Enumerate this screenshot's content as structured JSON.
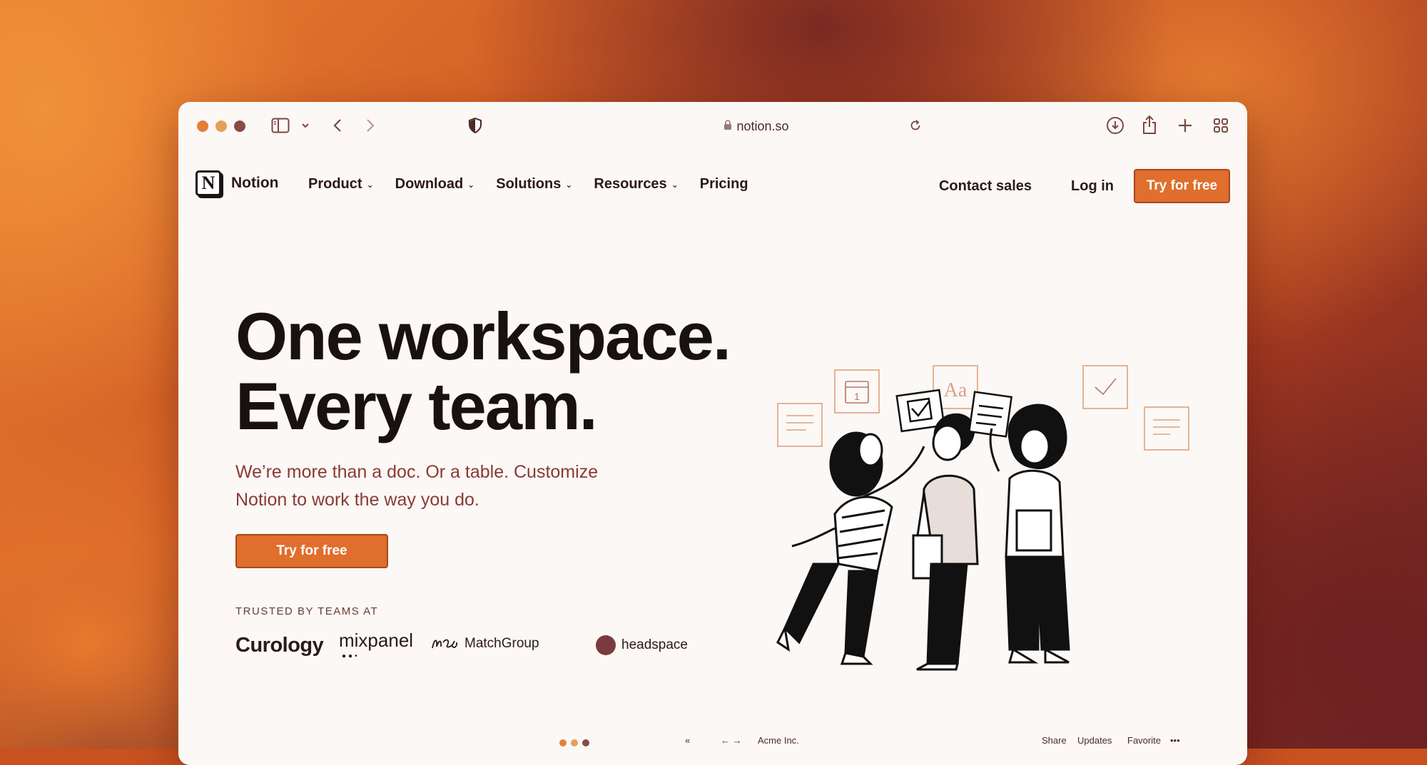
{
  "colors": {
    "accent": "#e06e2c",
    "text_dark": "#191111",
    "text_sub": "#8a3a33",
    "traffic_red": "#e47f3a",
    "traffic_yellow": "#e4a05a",
    "traffic_green": "#8a4a45"
  },
  "browser": {
    "url": "notion.so",
    "icons": [
      "sidebar-icon",
      "chevron-down-icon",
      "back-icon",
      "forward-icon",
      "shield-icon",
      "lock-icon",
      "reload-icon",
      "download-icon",
      "share-icon",
      "new-tab-icon",
      "tab-overview-icon"
    ]
  },
  "nav": {
    "brand": "Notion",
    "logo_letter": "N",
    "items": [
      {
        "label": "Product",
        "dropdown": true
      },
      {
        "label": "Download",
        "dropdown": true
      },
      {
        "label": "Solutions",
        "dropdown": true
      },
      {
        "label": "Resources",
        "dropdown": true
      },
      {
        "label": "Pricing",
        "dropdown": false
      }
    ],
    "contact_sales": "Contact sales",
    "login": "Log in",
    "cta": "Try for free"
  },
  "hero": {
    "title_line1": "One workspace.",
    "title_line2": "Every team.",
    "subtitle": "We’re more than a doc. Or a table. Customize Notion to work the way you do.",
    "cta": "Try for free",
    "trusted_label": "TRUSTED BY TEAMS AT",
    "logos": {
      "curology": "Curology",
      "mixpanel": "mixpanel",
      "matchgroup": "MatchGroup",
      "headspace": "headspace"
    }
  },
  "illustration": {
    "card_glyph": "Aa",
    "calendar_day": "1"
  },
  "bottom_peek": {
    "chevron": "«",
    "arrows": "← →",
    "workspace": "Acme Inc.",
    "actions": [
      "Share",
      "Updates",
      "Favorite",
      "•••"
    ]
  }
}
